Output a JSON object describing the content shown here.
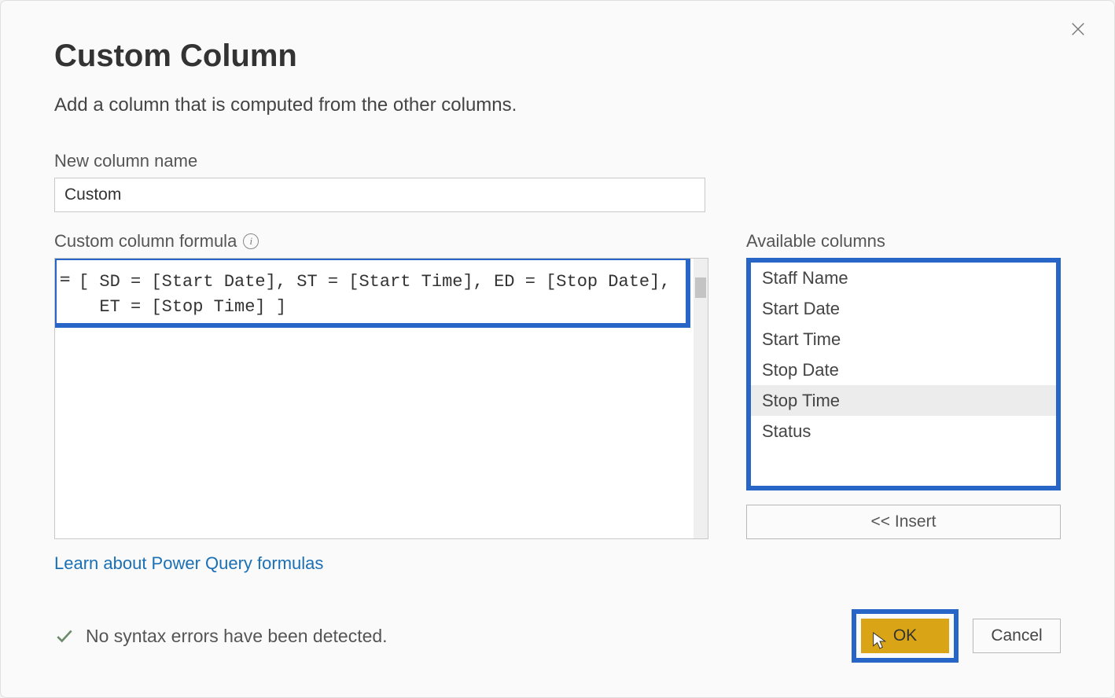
{
  "dialog": {
    "title": "Custom Column",
    "subtitle": "Add a column that is computed from the other columns.",
    "name_label": "New column name",
    "name_value": "Custom",
    "formula_label": "Custom column formula",
    "formula_prefix": "=",
    "formula_text": "[ SD = [Start Date], ST = [Start Time], ED = [Stop Date],\n  ET = [Stop Time] ]",
    "learn_link": "Learn about Power Query formulas",
    "available_label": "Available columns",
    "available_columns": [
      {
        "label": "Staff Name",
        "selected": false
      },
      {
        "label": "Start Date",
        "selected": false
      },
      {
        "label": "Start Time",
        "selected": false
      },
      {
        "label": "Stop Date",
        "selected": false
      },
      {
        "label": "Stop Time",
        "selected": true
      },
      {
        "label": "Status",
        "selected": false
      }
    ],
    "insert_label": "<< Insert",
    "status_text": "No syntax errors have been detected.",
    "ok_label": "OK",
    "cancel_label": "Cancel",
    "highlight_color": "#2766c6",
    "ok_color": "#d9a416"
  }
}
